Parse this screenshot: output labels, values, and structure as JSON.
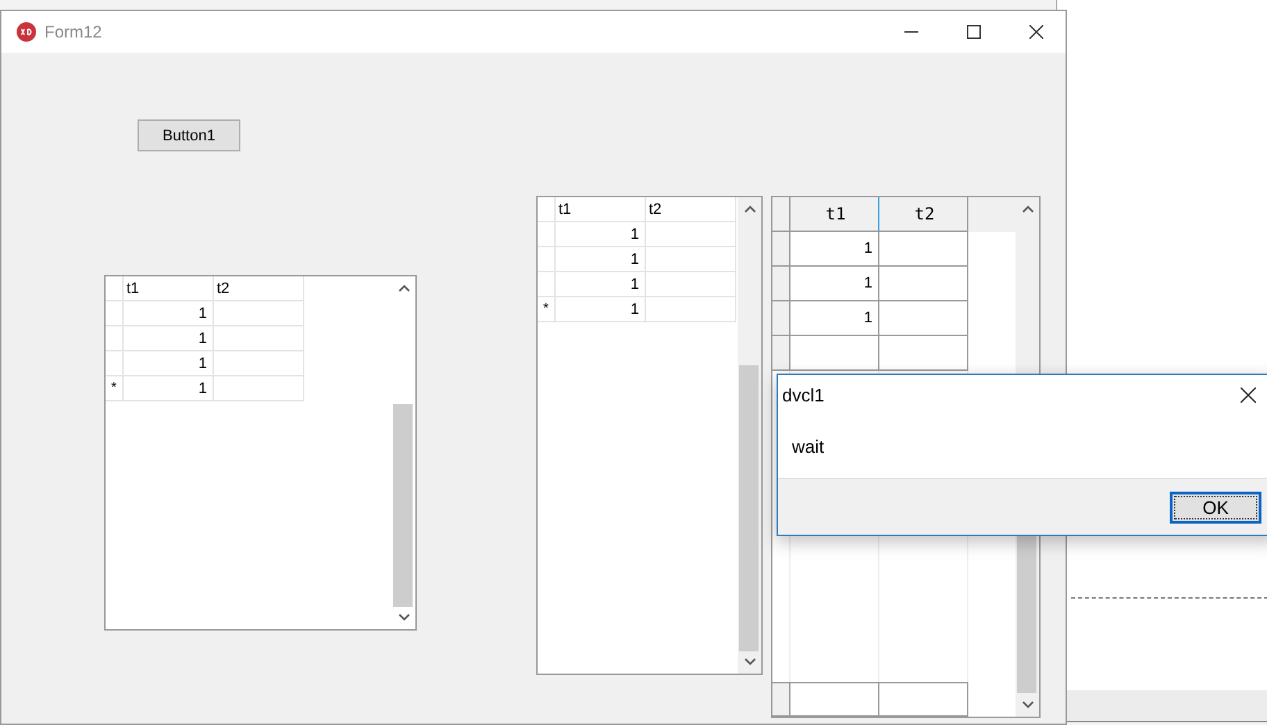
{
  "window": {
    "title": "Form12"
  },
  "button": {
    "label": "Button1"
  },
  "grids": [
    {
      "kind": "small",
      "columns": [
        "t1",
        "t2"
      ],
      "rows": [
        {
          "values": [
            "1"
          ]
        },
        {
          "values": [
            "1"
          ]
        },
        {
          "values": [
            "1"
          ]
        },
        {
          "indicator": "*",
          "values": [
            "1"
          ]
        }
      ]
    },
    {
      "kind": "small",
      "columns": [
        "t1",
        "t2"
      ],
      "rows": [
        {
          "values": [
            "1"
          ]
        },
        {
          "values": [
            "1"
          ]
        },
        {
          "values": [
            "1"
          ]
        },
        {
          "indicator": "*",
          "values": [
            "1"
          ]
        }
      ]
    },
    {
      "kind": "large",
      "columns": [
        "t1",
        "t2"
      ],
      "rows": [
        {
          "values": [
            "1"
          ]
        },
        {
          "values": [
            "1"
          ]
        },
        {
          "values": [
            "1"
          ]
        }
      ]
    }
  ],
  "dialog": {
    "title": "dvcl1",
    "message": "wait",
    "button": "OK"
  }
}
